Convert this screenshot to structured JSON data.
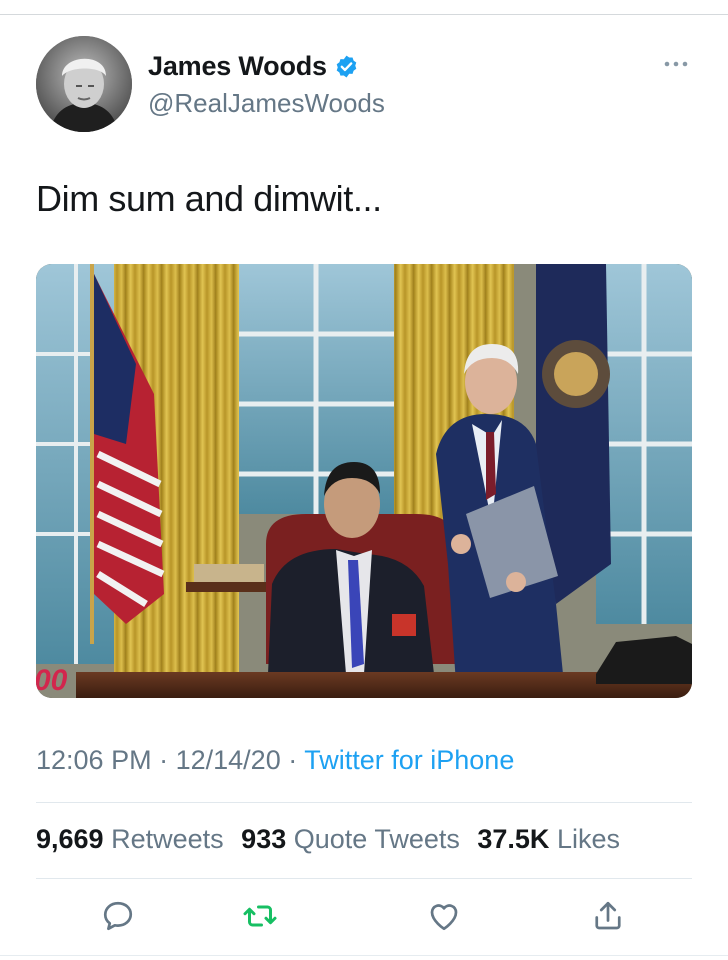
{
  "author": {
    "display_name": "James Woods",
    "handle": "@RealJamesWoods",
    "verified": true
  },
  "tweet": {
    "text": "Dim sum and dimwit...",
    "time": "12:06 PM",
    "separator": "·",
    "date": "12/14/20",
    "source": "Twitter for iPhone",
    "media_overlay_text": "00"
  },
  "stats": {
    "retweets_count": "9,669",
    "retweets_label": "Retweets",
    "quotes_count": "933",
    "quotes_label": "Quote Tweets",
    "likes_count": "37.5K",
    "likes_label": "Likes"
  },
  "actions": [
    "reply-icon",
    "retweet-icon",
    "like-icon",
    "share-icon"
  ],
  "colors": {
    "link": "#1da1f2",
    "retweet_green": "#17bf63",
    "secondary_text": "#657786",
    "verified": "#1da1f2"
  }
}
